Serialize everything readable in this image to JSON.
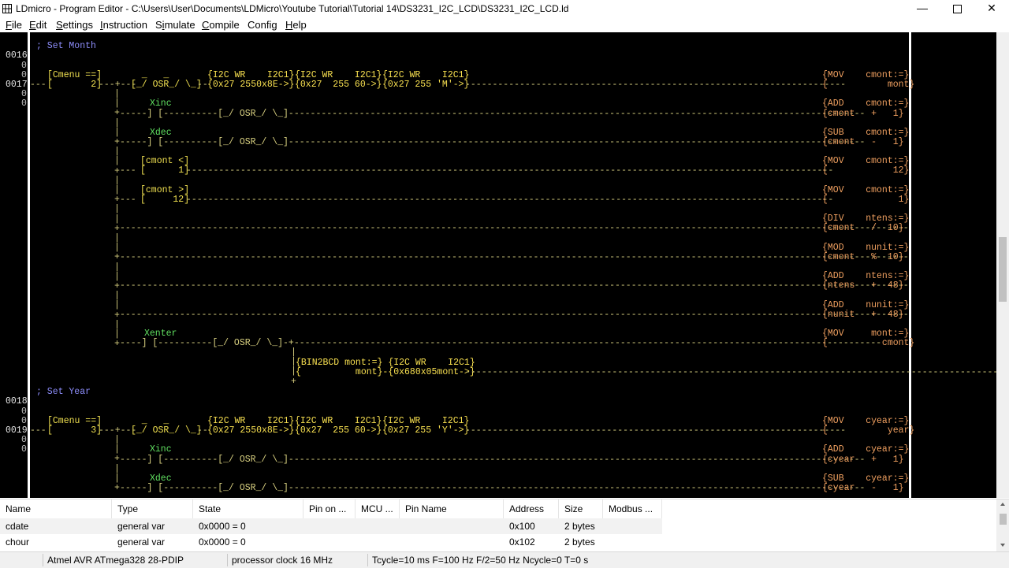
{
  "window": {
    "title": "LDmicro - Program Editor - C:\\Users\\User\\Documents\\LDMicro\\Youtube Tutorial\\Tutorial 14\\DS3231_I2C_LCD\\DS3231_I2C_LCD.ld",
    "minimize": "—",
    "close": "✕"
  },
  "menu": [
    {
      "label": "File",
      "key": "F",
      "rest": "ile"
    },
    {
      "label": "Edit",
      "key": "E",
      "rest": "dit"
    },
    {
      "label": "Settings",
      "key": "S",
      "rest": "ettings"
    },
    {
      "label": "Instruction",
      "key": "I",
      "rest": "nstruction"
    },
    {
      "label": "Simulate",
      "pre": "S",
      "key": "i",
      "rest": "mulate"
    },
    {
      "label": "Compile",
      "key": "C",
      "rest": "ompile"
    },
    {
      "label": "Config",
      "plain": "Config"
    },
    {
      "label": "Help",
      "key": "H",
      "rest": "elp"
    }
  ],
  "ladder": {
    "line_numbers": [
      "0016",
      "0",
      "0",
      "0017",
      "0",
      "0",
      "0018",
      "0",
      "0",
      "0019",
      "0",
      "0"
    ],
    "comment1": "; Set Month",
    "comment2": "; Set Year",
    "r0017": {
      "cond": "[Cmenu ==]",
      "cond_val": "[       2]",
      "osr_top": "  _   _",
      "osr": "[_/ OSR_/ \\_]",
      "i2c1_top": "{I2C WR    I2C1}",
      "i2c1_bot": "{0x27 2550x8E->}",
      "i2c2_top": "{I2C WR    I2C1}",
      "i2c2_bot": "{0x27  255 60->}",
      "i2c3_top": "{I2C WR    I2C1}",
      "i2c3_bot": "{0x27 255 'M'->}",
      "mov_top": "{MOV    cmont:=}",
      "mov_bot": "{           mont}"
    },
    "month_rungs": [
      {
        "name": "Xinc",
        "op_top": "{ADD    cmont:=}",
        "op_bot": "{cmont   +   1}"
      },
      {
        "name": "Xdec",
        "op_top": "{SUB    cmont:=}",
        "op_bot": "{cmont   -   1}"
      },
      {
        "cmp_top": "[cmont <]",
        "cmp_bot": "[      1]",
        "op_top": "{MOV    cmont:=}",
        "op_bot": "{            12}"
      },
      {
        "cmp_top": "[cmont >]",
        "cmp_bot": "[     12]",
        "op_top": "{MOV    cmont:=}",
        "op_bot": "{             1}"
      },
      {
        "op_top": "{DIV    ntens:=}",
        "op_bot": "{cmont   /  10}"
      },
      {
        "op_top": "{MOD    nunit:=}",
        "op_bot": "{cmont   %  10}"
      },
      {
        "op_top": "{ADD    ntens:=}",
        "op_bot": "{ntens   +  48}"
      },
      {
        "op_top": "{ADD    nunit:=}",
        "op_bot": "{nunit   +  48}"
      },
      {
        "name": "Xenter",
        "op_top": "{MOV     mont:=}",
        "op_bot": "{          cmont}"
      }
    ],
    "bin_top": "{BIN2BCD mont:=} {I2C WR    I2C1}",
    "bin_bot": "{          mont}-{0x680x05mont->}",
    "r0019": {
      "cond": "[Cmenu ==]",
      "cond_val": "[       3]",
      "i2c3_bot": "{0x27 255 'Y'->}",
      "mov_top": "{MOV    cyear:=}",
      "mov_bot": "{           year}"
    },
    "year_rungs": [
      {
        "name": "Xinc",
        "op_top": "{ADD    cyear:=}",
        "op_bot": "{cyear   +   1}"
      },
      {
        "name": "Xdec",
        "op_top": "{SUB    cyear:=}",
        "op_bot": "{cyear   -   1}"
      }
    ]
  },
  "varlist": {
    "columns": [
      "Name",
      "Type",
      "State",
      "Pin on ...",
      "MCU ...",
      "Pin Name",
      "Address",
      "Size",
      "Modbus ..."
    ],
    "rows": [
      {
        "name": "cdate",
        "type": "general var",
        "state": "0x0000 = 0",
        "address": "0x100",
        "size": "2 bytes"
      },
      {
        "name": "chour",
        "type": "general var",
        "state": "0x0000 = 0",
        "address": "0x102",
        "size": "2 bytes"
      }
    ]
  },
  "status": {
    "mcu": "Atmel AVR ATmega328 28-PDIP",
    "clock": "processor clock 16 MHz",
    "timing": "Tcycle=10 ms F=100 Hz F/2=50 Hz Ncycle=0 T=0 s"
  }
}
